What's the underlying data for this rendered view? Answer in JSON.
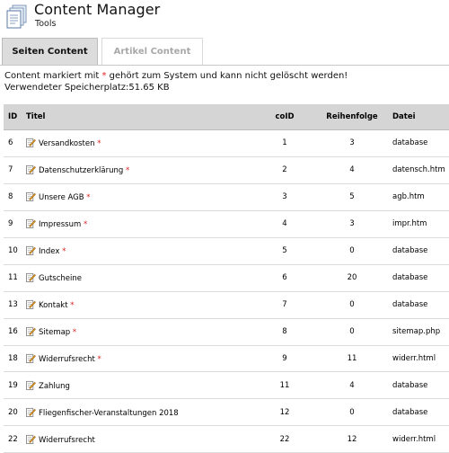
{
  "app": {
    "title": "Content Manager",
    "subtitle": "Tools",
    "icon": "documents-icon"
  },
  "tabs": [
    {
      "label": "Seiten Content",
      "active": true
    },
    {
      "label": "Artikel Content",
      "active": false
    }
  ],
  "info": {
    "line1_before": "Content markiert mit ",
    "line1_mark": "*",
    "line1_after": " gehört zum System und kann nicht gelöscht werden!",
    "line2": "Verwendeter Speicherplatz:51.65 KB"
  },
  "table": {
    "headers": {
      "id": "ID",
      "title": "Titel",
      "coid": "coID",
      "order": "Reihenfolge",
      "file": "Datei"
    },
    "rows": [
      {
        "id": "6",
        "title": "Versandkosten",
        "system": true,
        "coid": "1",
        "order": "3",
        "file": "database"
      },
      {
        "id": "7",
        "title": "Datenschutzerklärung",
        "system": true,
        "coid": "2",
        "order": "4",
        "file": "datensch.htm"
      },
      {
        "id": "8",
        "title": "Unsere AGB",
        "system": true,
        "coid": "3",
        "order": "5",
        "file": "agb.htm"
      },
      {
        "id": "9",
        "title": "Impressum",
        "system": true,
        "coid": "4",
        "order": "3",
        "file": "impr.htm"
      },
      {
        "id": "10",
        "title": "Index",
        "system": true,
        "coid": "5",
        "order": "0",
        "file": "database"
      },
      {
        "id": "11",
        "title": "Gutscheine",
        "system": false,
        "coid": "6",
        "order": "20",
        "file": "database"
      },
      {
        "id": "13",
        "title": "Kontakt",
        "system": true,
        "coid": "7",
        "order": "0",
        "file": "database"
      },
      {
        "id": "16",
        "title": "Sitemap",
        "system": true,
        "coid": "8",
        "order": "0",
        "file": "sitemap.php"
      },
      {
        "id": "18",
        "title": "Widerrufsrecht",
        "system": true,
        "coid": "9",
        "order": "11",
        "file": "widerr.html"
      },
      {
        "id": "19",
        "title": "Zahlung",
        "system": false,
        "coid": "11",
        "order": "4",
        "file": "database"
      },
      {
        "id": "20",
        "title": "Fliegenfischer-Veranstaltungen 2018",
        "system": false,
        "coid": "12",
        "order": "0",
        "file": "database"
      },
      {
        "id": "22",
        "title": "Widerrufsrecht",
        "system": false,
        "coid": "22",
        "order": "12",
        "file": "widerr.html"
      }
    ]
  },
  "colors": {
    "system_marker": "#dd2222",
    "header_bg": "#d5d5d5",
    "tab_active_bg": "#dcdcdc",
    "tab_inactive_text": "#a8a8a8"
  }
}
